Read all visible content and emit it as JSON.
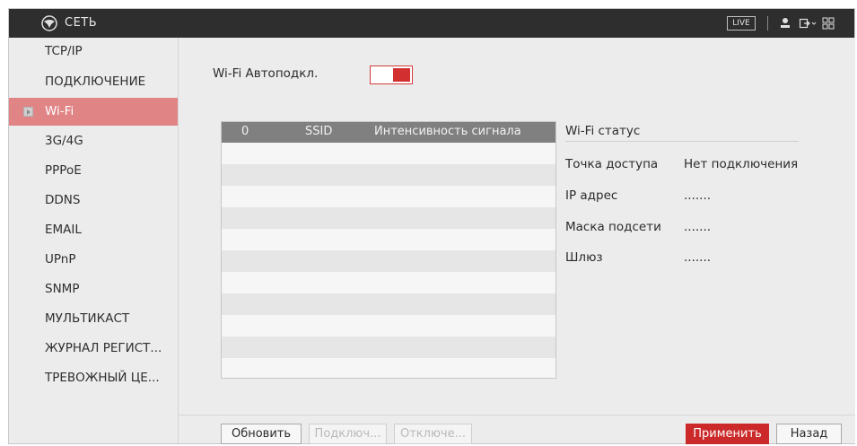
{
  "header": {
    "title": "СЕТЬ",
    "live_label": "LIVE",
    "icons": [
      "logo-icon",
      "user-icon",
      "logout-icon",
      "grid-icon"
    ]
  },
  "sidebar": {
    "items": [
      {
        "label": "TCP/IP",
        "active": false
      },
      {
        "label": "ПОДКЛЮЧЕНИЕ",
        "active": false
      },
      {
        "label": "Wi-Fi",
        "active": true
      },
      {
        "label": "3G/4G",
        "active": false
      },
      {
        "label": "PPPoE",
        "active": false
      },
      {
        "label": "DDNS",
        "active": false
      },
      {
        "label": "EMAIL",
        "active": false
      },
      {
        "label": "UPnP",
        "active": false
      },
      {
        "label": "SNMP",
        "active": false
      },
      {
        "label": "МУЛЬТИКАСТ",
        "active": false
      },
      {
        "label": "ЖУРНАЛ РЕГИСТ...",
        "active": false
      },
      {
        "label": "ТРЕВОЖНЫЙ ЦЕ...",
        "active": false
      }
    ]
  },
  "main": {
    "autoconnect_label": "Wi-Fi Автоподкл.",
    "autoconnect_on": true,
    "table": {
      "columns": [
        "0",
        "SSID",
        "Интенсивность сигнала"
      ],
      "rows": []
    },
    "status": {
      "title": "Wi-Fi статус",
      "fields": [
        {
          "label": "Точка доступа",
          "value": "Нет подключения"
        },
        {
          "label": "IP адрес",
          "value": "......."
        },
        {
          "label": "Маска подсети",
          "value": "......."
        },
        {
          "label": "Шлюз",
          "value": "......."
        }
      ]
    }
  },
  "footer": {
    "refresh": "Обновить",
    "connect": "Подключ...",
    "disconnect": "Отключе...",
    "apply": "Применить",
    "back": "Назад"
  },
  "colors": {
    "titlebar": "#2e2e2e",
    "active_item": "#e08486",
    "accent": "#cc2a2a",
    "table_header": "#808080"
  }
}
